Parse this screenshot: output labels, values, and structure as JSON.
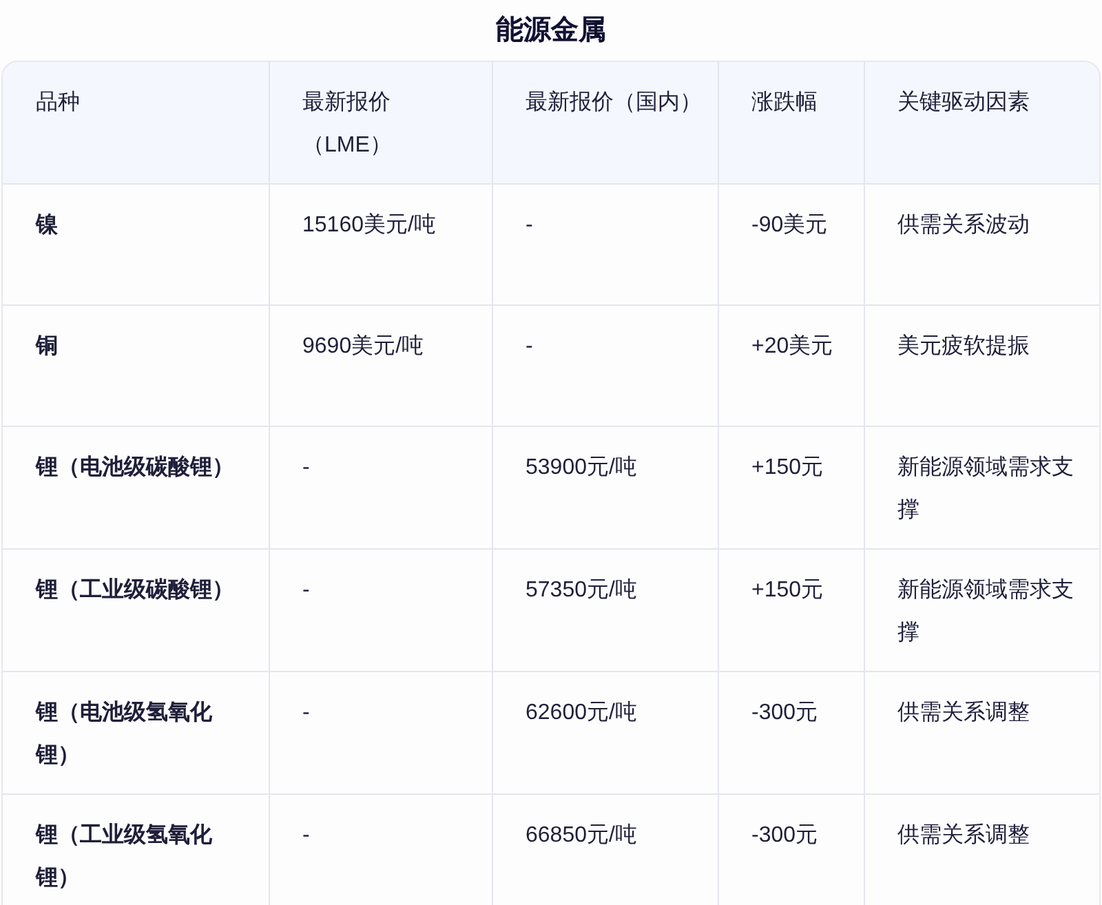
{
  "title": "能源金属",
  "table": {
    "columns": [
      "品种",
      "最新报价（LME）",
      "最新报价（国内）",
      "涨跌幅",
      "关键驱动因素"
    ],
    "rows": [
      [
        "镍",
        "15160美元/吨",
        "-",
        "-90美元",
        "供需关系波动"
      ],
      [
        "铜",
        "9690美元/吨",
        "-",
        "+20美元",
        "美元疲软提振"
      ],
      [
        "锂（电池级碳酸锂）",
        "-",
        "53900元/吨",
        "+150元",
        "新能源领域需求支撑"
      ],
      [
        "锂（工业级碳酸锂）",
        "-",
        "57350元/吨",
        "+150元",
        "新能源领域需求支撑"
      ],
      [
        "锂（电池级氢氧化锂）",
        "-",
        "62600元/吨",
        "-300元",
        "供需关系调整"
      ],
      [
        "锂（工业级氢氧化锂）",
        "-",
        "66850元/吨",
        "-300元",
        "供需关系调整"
      ]
    ]
  }
}
